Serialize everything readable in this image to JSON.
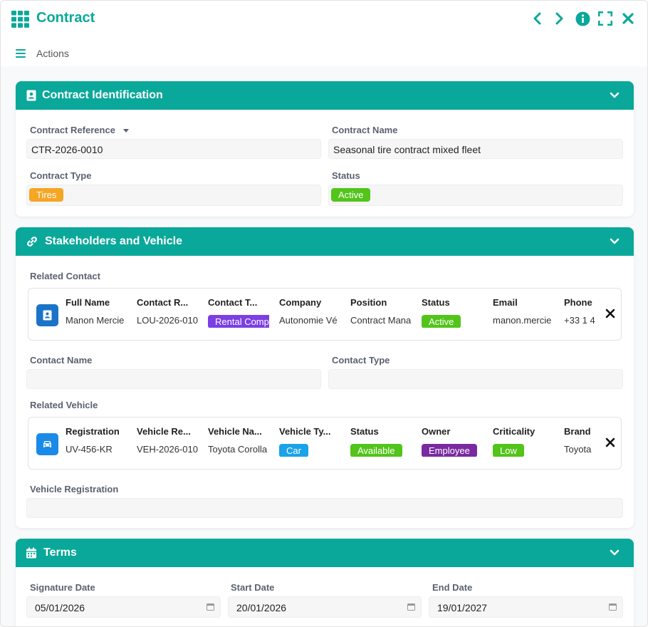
{
  "header": {
    "title": "Contract",
    "actions_label": "Actions"
  },
  "colors": {
    "accent": "#0aa89a",
    "tires": "#f5a623",
    "active": "#52c41a",
    "rental": "#7b3fe4",
    "car": "#1aa3e8",
    "employee": "#7a2aa0"
  },
  "identification": {
    "title": "Contract Identification",
    "reference_label": "Contract Reference",
    "reference_value": "CTR-2026-0010",
    "name_label": "Contract Name",
    "name_value": "Seasonal tire contract mixed fleet",
    "type_label": "Contract Type",
    "type_value": "Tires",
    "status_label": "Status",
    "status_value": "Active"
  },
  "stakeholders": {
    "title": "Stakeholders and Vehicle",
    "related_contact_label": "Related Contact",
    "contact": {
      "columns": [
        {
          "header": "Full Name",
          "value": "Manon Mercie"
        },
        {
          "header": "Contact R...",
          "value": "LOU-2026-010"
        },
        {
          "header": "Contact T...",
          "value": "Rental Comp"
        },
        {
          "header": "Company",
          "value": "Autonomie Vé"
        },
        {
          "header": "Position",
          "value": "Contract Mana"
        },
        {
          "header": "Status",
          "value": "Active"
        },
        {
          "header": "Email",
          "value": "manon.mercie"
        },
        {
          "header": "Phone",
          "value": "+33 1 4"
        }
      ]
    },
    "contact_name_label": "Contact Name",
    "contact_type_label": "Contact Type",
    "related_vehicle_label": "Related Vehicle",
    "vehicle": {
      "columns": [
        {
          "header": "Registration",
          "value": "UV-456-KR"
        },
        {
          "header": "Vehicle Re...",
          "value": "VEH-2026-010"
        },
        {
          "header": "Vehicle Na...",
          "value": "Toyota Corolla"
        },
        {
          "header": "Vehicle Ty...",
          "value": "Car"
        },
        {
          "header": "Status",
          "value": "Available"
        },
        {
          "header": "Owner",
          "value": "Employee"
        },
        {
          "header": "Criticality",
          "value": "Low"
        },
        {
          "header": "Brand",
          "value": "Toyota"
        }
      ]
    },
    "vehicle_registration_label": "Vehicle Registration"
  },
  "terms": {
    "title": "Terms",
    "signature_label": "Signature Date",
    "signature_value": "05/01/2026",
    "start_label": "Start Date",
    "start_value": "20/01/2026",
    "end_label": "End Date",
    "end_value": "19/01/2027"
  }
}
